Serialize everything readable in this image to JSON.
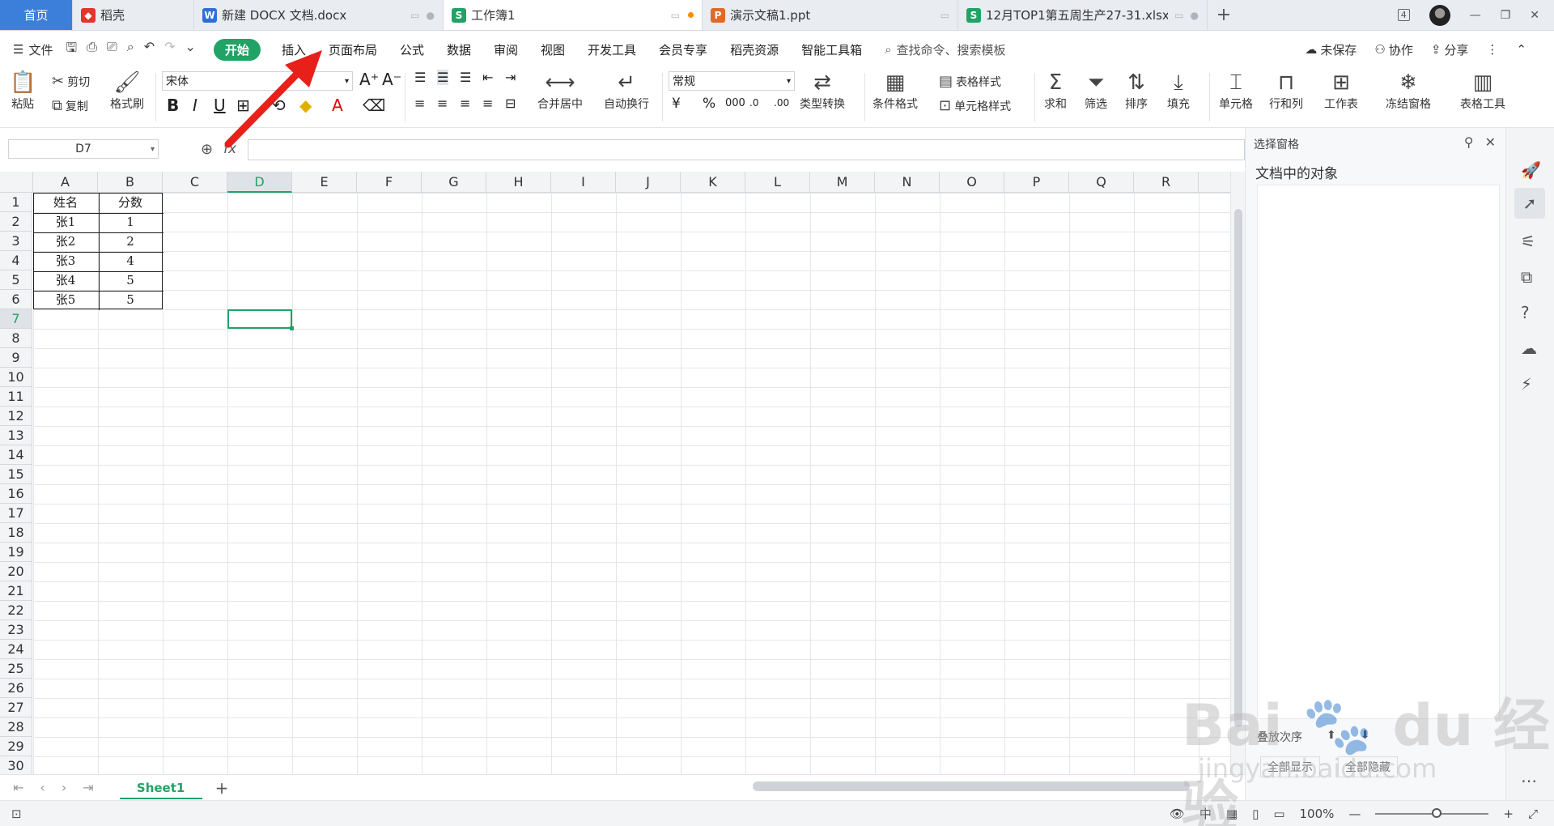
{
  "tabs": [
    {
      "label": "首页",
      "type": "home"
    },
    {
      "label": "稻壳",
      "icon": "daoke-icon",
      "color": "#e0362c"
    },
    {
      "label": "新建 DOCX 文档.docx",
      "icon": "writer-icon",
      "color": "#2f6fd8"
    },
    {
      "label": "工作簿1",
      "icon": "sheet-icon",
      "color": "#21a366",
      "active": true
    },
    {
      "label": "演示文稿1.ppt",
      "icon": "ppt-icon",
      "color": "#e06a2c"
    },
    {
      "label": "12月TOP1第五周生产27-31.xlsx",
      "icon": "sheet-icon",
      "color": "#21a366"
    }
  ],
  "window_count": "4",
  "menu": {
    "file": "文件",
    "tabs": [
      "开始",
      "插入",
      "页面布局",
      "公式",
      "数据",
      "审阅",
      "视图",
      "开发工具",
      "会员专享",
      "稻壳资源",
      "智能工具箱"
    ],
    "search_placeholder": "查找命令、搜索模板",
    "unsaved": "未保存",
    "collab": "协作",
    "share": "分享"
  },
  "ribbon": {
    "paste": "粘贴",
    "cut": "剪切",
    "copy": "复制",
    "format_painter": "格式刷",
    "font_name": "宋体",
    "number_format": "常规",
    "merge_center": "合并居中",
    "wrap_text": "自动换行",
    "type_convert": "类型转换",
    "cond_format": "条件格式",
    "table_style": "表格样式",
    "cell_style": "单元格样式",
    "sum": "求和",
    "filter": "筛选",
    "sort": "排序",
    "fill": "填充",
    "cell": "单元格",
    "row_col": "行和列",
    "worksheet": "工作表",
    "freeze": "冻结窗格",
    "table_tools": "表格工具"
  },
  "formula_bar": {
    "name_box": "D7",
    "fx_label": "fx"
  },
  "columns": [
    "A",
    "B",
    "C",
    "D",
    "E",
    "F",
    "G",
    "H",
    "I",
    "J",
    "K",
    "L",
    "M",
    "N",
    "O",
    "P",
    "Q",
    "R"
  ],
  "selected_column": "D",
  "rows": [
    "1",
    "2",
    "3",
    "4",
    "5",
    "6",
    "7",
    "8",
    "9",
    "10",
    "11",
    "12",
    "13",
    "14",
    "15",
    "16",
    "17",
    "18",
    "19",
    "20",
    "21",
    "22",
    "23",
    "24",
    "25",
    "26",
    "27",
    "28",
    "29",
    "30"
  ],
  "selected_row": "7",
  "table": {
    "headers": [
      "姓名",
      "分数"
    ],
    "rows": [
      [
        "张1",
        "1"
      ],
      [
        "张2",
        "2"
      ],
      [
        "张3",
        "4"
      ],
      [
        "张4",
        "5"
      ],
      [
        "张5",
        "5"
      ]
    ]
  },
  "sheet_tab": "Sheet1",
  "selection_pane": {
    "title": "选择窗格",
    "subtitle": "文档中的对象",
    "show_all": "全部显示",
    "hide_all": "全部隐藏",
    "order_label": "叠放次序"
  },
  "status": {
    "zoom": "100%"
  },
  "watermark": {
    "brand": "Bai du 经验",
    "url": "jingyan.baidu.com"
  }
}
